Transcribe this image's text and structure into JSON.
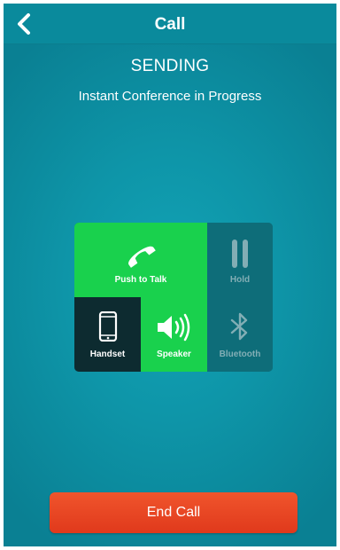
{
  "header": {
    "title": "Call",
    "back_icon": "chevron-left-icon"
  },
  "status": {
    "state": "SENDING",
    "detail": "Instant Conference in Progress"
  },
  "controls": {
    "push_to_talk": {
      "label": "Push to Talk",
      "icon": "phone-icon",
      "active": true
    },
    "hold": {
      "label": "Hold",
      "icon": "pause-icon",
      "active": false
    },
    "handset": {
      "label": "Handset",
      "icon": "smartphone-icon",
      "selected": true
    },
    "speaker": {
      "label": "Speaker",
      "icon": "speaker-icon",
      "active": true
    },
    "bluetooth": {
      "label": "Bluetooth",
      "icon": "bluetooth-icon",
      "active": false
    }
  },
  "end_call": {
    "label": "End Call"
  },
  "colors": {
    "accent_green": "#19d14d",
    "end_call_red": "#e8451f",
    "teal_background": "#0e95a8",
    "disabled_tile": "#0e6d79"
  }
}
